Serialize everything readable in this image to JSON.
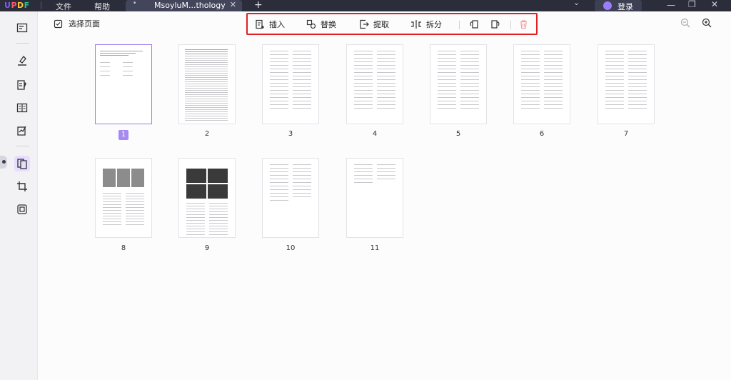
{
  "app": {
    "logo": [
      "U",
      "P",
      "D",
      "F"
    ],
    "menu": {
      "file": "文件",
      "help": "帮助"
    },
    "tab": {
      "dot": "•",
      "name": "MsoyluM...thology",
      "close": "✕"
    },
    "new_tab": "+",
    "login": "登录",
    "window": {
      "minimize": "—",
      "restore": "❐",
      "close": "✕"
    }
  },
  "header": {
    "select_pages": "选择页面"
  },
  "toolbar": {
    "insert": "插入",
    "replace": "替换",
    "extract": "提取",
    "split": "拆分"
  },
  "pages": [
    {
      "label": "1",
      "selected": true
    },
    {
      "label": "2",
      "selected": false
    },
    {
      "label": "3",
      "selected": false
    },
    {
      "label": "4",
      "selected": false
    },
    {
      "label": "5",
      "selected": false
    },
    {
      "label": "6",
      "selected": false
    },
    {
      "label": "7",
      "selected": false
    },
    {
      "label": "8",
      "selected": false
    },
    {
      "label": "9",
      "selected": false
    },
    {
      "label": "10",
      "selected": false
    },
    {
      "label": "11",
      "selected": false
    }
  ],
  "colors": {
    "accent": "#a58af0",
    "highlight": "#e02020",
    "titlebar": "#2c2d3a"
  }
}
